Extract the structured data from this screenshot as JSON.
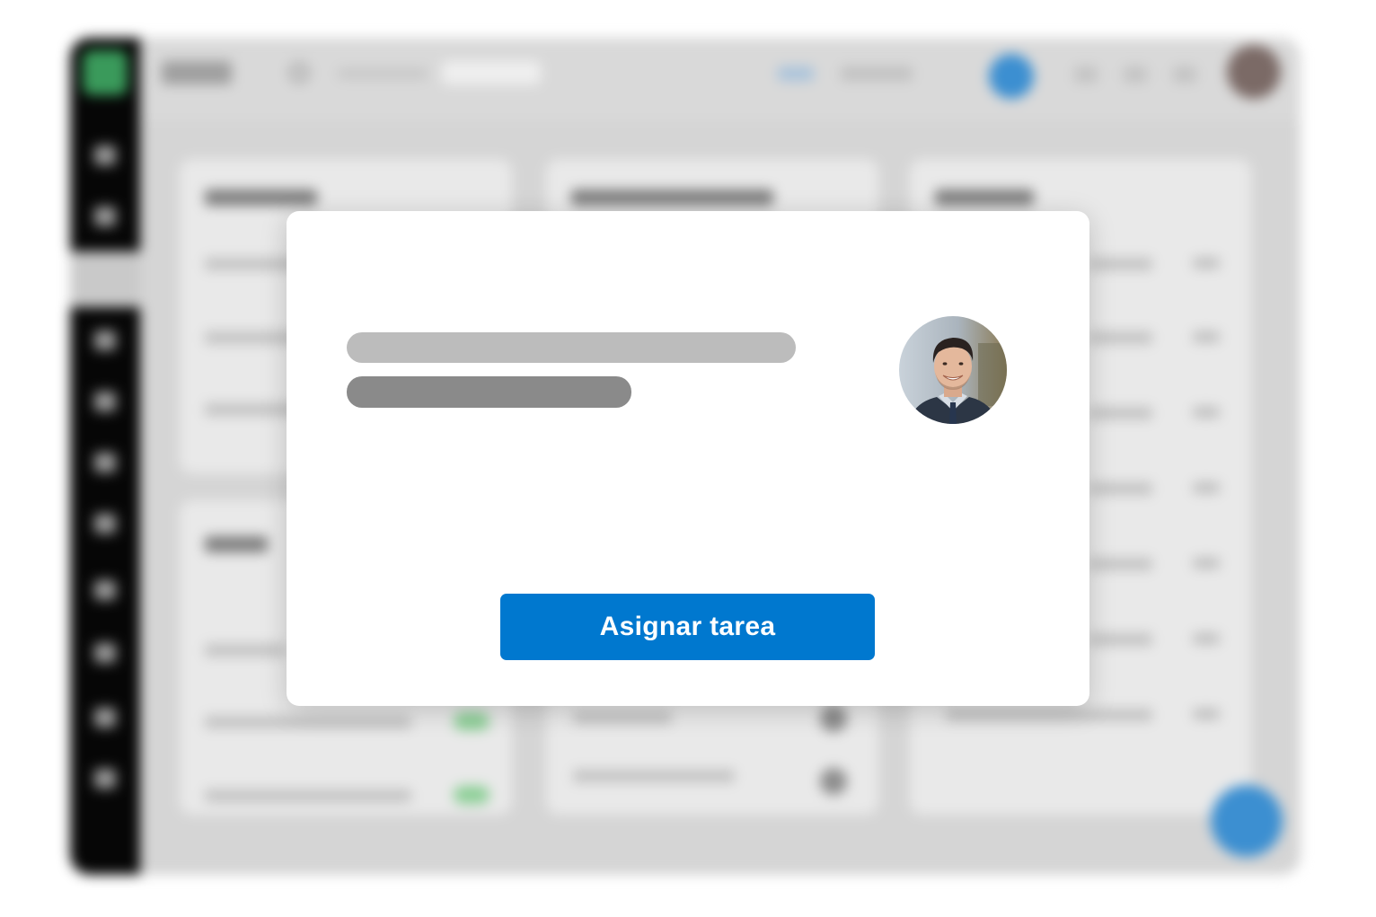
{
  "modal": {
    "assign_button_label": "Asignar tarea",
    "accent_color": "#0078cf"
  },
  "icons": {
    "avatar": "user-avatar-photo",
    "search": "search-icon",
    "fab": "add-icon"
  },
  "colors": {
    "sidebar": "#060606",
    "logo": "#3a9a5b",
    "status_green": "#8ccf96",
    "brand_blue": "#3c8fd1"
  }
}
